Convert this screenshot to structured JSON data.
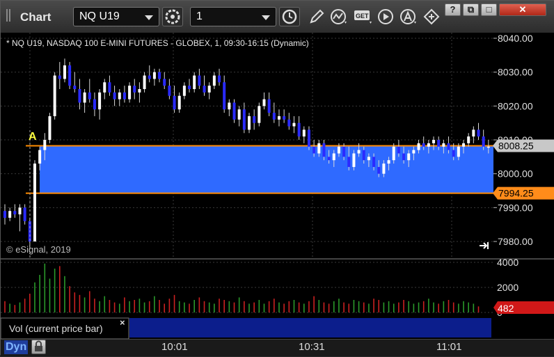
{
  "window": {
    "title": "Chart",
    "symbol": "NQ U19",
    "interval": "1",
    "buttons": [
      "help-button",
      "restore-button",
      "maximize-button",
      "close-button"
    ],
    "button_glyphs": [
      "?",
      "⧉",
      "□",
      "✕"
    ]
  },
  "toolbar": {
    "icons": [
      "settings-icon",
      "clock-icon",
      "pencil-icon",
      "studies-icon",
      "get-icon",
      "play-icon",
      "alert-icon",
      "diamond-arrows-icon"
    ]
  },
  "chart": {
    "header": "* NQ U19, NASDAQ 100 E-MINI FUTURES - GLOBEX, 1, 09:30-16:15 (Dynamic)",
    "copyright": "© eSignal, 2019",
    "marker_label": "A",
    "price_ticks": [
      "8040.00",
      "8030.00",
      "8020.00",
      "8010.00",
      "8000.00",
      "7990.00",
      "7980.00"
    ],
    "price_tags": [
      "8008.25",
      "7994.25"
    ],
    "volume_ticks": [
      "4000",
      "2000",
      "0"
    ],
    "volume_tag": "482",
    "volume_label": "Vol (current price bar)",
    "time_labels": [
      "10:01",
      "10:31",
      "11:01"
    ]
  },
  "status": {
    "mode": "Dyn"
  },
  "chart_data": {
    "type": "candlestick",
    "x_labels": [
      "10:01",
      "10:31",
      "11:01"
    ],
    "y_range": [
      7978,
      8042
    ],
    "range_band": {
      "upper": 8008.25,
      "lower": 7994.25
    },
    "volume_range": [
      0,
      4000
    ],
    "colors": {
      "up": "#ffffff",
      "down": "#2a2aff",
      "band": "#2f6aff",
      "band_edge": "#ff8c00",
      "vol_up": "#2a9a2a",
      "vol_down": "#cc2020"
    },
    "ohlc": [
      [
        7989,
        7991,
        7985,
        7987
      ],
      [
        7987,
        7990,
        7986,
        7989
      ],
      [
        7989,
        7991,
        7987,
        7988
      ],
      [
        7988,
        7991,
        7983,
        7990
      ],
      [
        7990,
        7991,
        7985,
        7986
      ],
      [
        7986,
        7987,
        7978,
        7980
      ],
      [
        7980,
        8004,
        7980,
        8003
      ],
      [
        8003,
        8008,
        8001,
        8007
      ],
      [
        8007,
        8012,
        8004,
        8010
      ],
      [
        8010,
        8018,
        8009,
        8017
      ],
      [
        8017,
        8030,
        8016,
        8029
      ],
      [
        8029,
        8033,
        8025,
        8028
      ],
      [
        8028,
        8034,
        8027,
        8032
      ],
      [
        8032,
        8033,
        8025,
        8026
      ],
      [
        8026,
        8030,
        8024,
        8025
      ],
      [
        8025,
        8028,
        8019,
        8021
      ],
      [
        8021,
        8025,
        8018,
        8024
      ],
      [
        8024,
        8028,
        8021,
        8022
      ],
      [
        8022,
        8024,
        8017,
        8019
      ],
      [
        8019,
        8025,
        8016,
        8024
      ],
      [
        8024,
        8028,
        8022,
        8027
      ],
      [
        8027,
        8029,
        8023,
        8024
      ],
      [
        8024,
        8026,
        8020,
        8022
      ],
      [
        8022,
        8025,
        8020,
        8024
      ],
      [
        8024,
        8026,
        8021,
        8022
      ],
      [
        8022,
        8027,
        8021,
        8026
      ],
      [
        8026,
        8028,
        8022,
        8024
      ],
      [
        8024,
        8027,
        8021,
        8025
      ],
      [
        8025,
        8030,
        8024,
        8029
      ],
      [
        8029,
        8032,
        8027,
        8028
      ],
      [
        8028,
        8031,
        8026,
        8030
      ],
      [
        8030,
        8031,
        8027,
        8028
      ],
      [
        8028,
        8030,
        8025,
        8026
      ],
      [
        8026,
        8028,
        8022,
        8023
      ],
      [
        8023,
        8026,
        8018,
        8019
      ],
      [
        8019,
        8024,
        8018,
        8023
      ],
      [
        8023,
        8027,
        8022,
        8026
      ],
      [
        8026,
        8028,
        8024,
        8025
      ],
      [
        8025,
        8030,
        8024,
        8029
      ],
      [
        8029,
        8031,
        8025,
        8026
      ],
      [
        8026,
        8029,
        8023,
        8024
      ],
      [
        8024,
        8027,
        8022,
        8026
      ],
      [
        8026,
        8030,
        8025,
        8029
      ],
      [
        8029,
        8031,
        8026,
        8027
      ],
      [
        8027,
        8029,
        8018,
        8019
      ],
      [
        8019,
        8022,
        8017,
        8021
      ],
      [
        8021,
        8022,
        8015,
        8016
      ],
      [
        8016,
        8020,
        8014,
        8019
      ],
      [
        8019,
        8021,
        8012,
        8013
      ],
      [
        8013,
        8018,
        8012,
        8017
      ],
      [
        8017,
        8019,
        8013,
        8015
      ],
      [
        8015,
        8021,
        8014,
        8020
      ],
      [
        8020,
        8024,
        8019,
        8022
      ],
      [
        8022,
        8024,
        8017,
        8018
      ],
      [
        8018,
        8021,
        8015,
        8016
      ],
      [
        8016,
        8019,
        8014,
        8017
      ],
      [
        8017,
        8019,
        8015,
        8016
      ],
      [
        8016,
        8018,
        8013,
        8014
      ],
      [
        8014,
        8017,
        8012,
        8015
      ],
      [
        8015,
        8017,
        8010,
        8011
      ],
      [
        8011,
        8014,
        8009,
        8013
      ],
      [
        8013,
        8014,
        8007,
        8008
      ],
      [
        8008,
        8010,
        8005,
        8006
      ],
      [
        8006,
        8010,
        8005,
        8009
      ],
      [
        8009,
        8010,
        8004,
        8005
      ],
      [
        8005,
        8007,
        8003,
        8004
      ],
      [
        8004,
        8007,
        8002,
        8006
      ],
      [
        8006,
        8009,
        8005,
        8008
      ],
      [
        8008,
        8009,
        8004,
        8005
      ],
      [
        8005,
        8008,
        8001,
        8002
      ],
      [
        8002,
        8007,
        8001,
        8006
      ],
      [
        8006,
        8009,
        8005,
        8007
      ],
      [
        8007,
        8008,
        8003,
        8004
      ],
      [
        8004,
        8006,
        8002,
        8005
      ],
      [
        8005,
        8006,
        8001,
        8002
      ],
      [
        8002,
        8004,
        7999,
        8000
      ],
      [
        8000,
        8004,
        7999,
        8003
      ],
      [
        8003,
        8005,
        8001,
        8004
      ],
      [
        8004,
        8009,
        8003,
        8008
      ],
      [
        8008,
        8010,
        8005,
        8006
      ],
      [
        8006,
        8008,
        8003,
        8004
      ],
      [
        8004,
        8007,
        8002,
        8006
      ],
      [
        8006,
        8008,
        8004,
        8007
      ],
      [
        8007,
        8010,
        8006,
        8009
      ],
      [
        8009,
        8011,
        8007,
        8008
      ],
      [
        8008,
        8010,
        8006,
        8009
      ],
      [
        8009,
        8011,
        8007,
        8010
      ],
      [
        8010,
        8011,
        8007,
        8008
      ],
      [
        8008,
        8010,
        8006,
        8009
      ],
      [
        8009,
        8011,
        8006,
        8007
      ],
      [
        8007,
        8009,
        8004,
        8005
      ],
      [
        8005,
        8009,
        8004,
        8008
      ],
      [
        8008,
        8010,
        8006,
        8009
      ],
      [
        8009,
        8012,
        8008,
        8011
      ],
      [
        8011,
        8014,
        8009,
        8013
      ],
      [
        8013,
        8015,
        8010,
        8011
      ],
      [
        8011,
        8013,
        8007,
        8008
      ],
      [
        8008,
        8010,
        8006,
        8008
      ]
    ],
    "volume": [
      900,
      700,
      600,
      800,
      1100,
      1500,
      2400,
      3000,
      3900,
      2700,
      3500,
      3700,
      2900,
      2100,
      1600,
      1400,
      1200,
      1700,
      1100,
      900,
      1300,
      1000,
      800,
      700,
      1200,
      900,
      1000,
      1100,
      800,
      900,
      1300,
      1000,
      700,
      1100,
      1400,
      900,
      800,
      700,
      1000,
      1200,
      900,
      800,
      700,
      1100,
      1000,
      900,
      800,
      1200,
      900,
      700,
      800,
      1000,
      700,
      900,
      1100,
      800,
      700,
      900,
      1000,
      800,
      700,
      900,
      1300,
      1000,
      800,
      700,
      900,
      1100,
      800,
      700,
      1000,
      900,
      800,
      700,
      1100,
      1000,
      800,
      900,
      700,
      800,
      1000,
      900,
      700,
      800,
      900,
      1100,
      800,
      700,
      900,
      1000,
      800,
      700,
      900,
      800,
      700,
      482
    ]
  }
}
